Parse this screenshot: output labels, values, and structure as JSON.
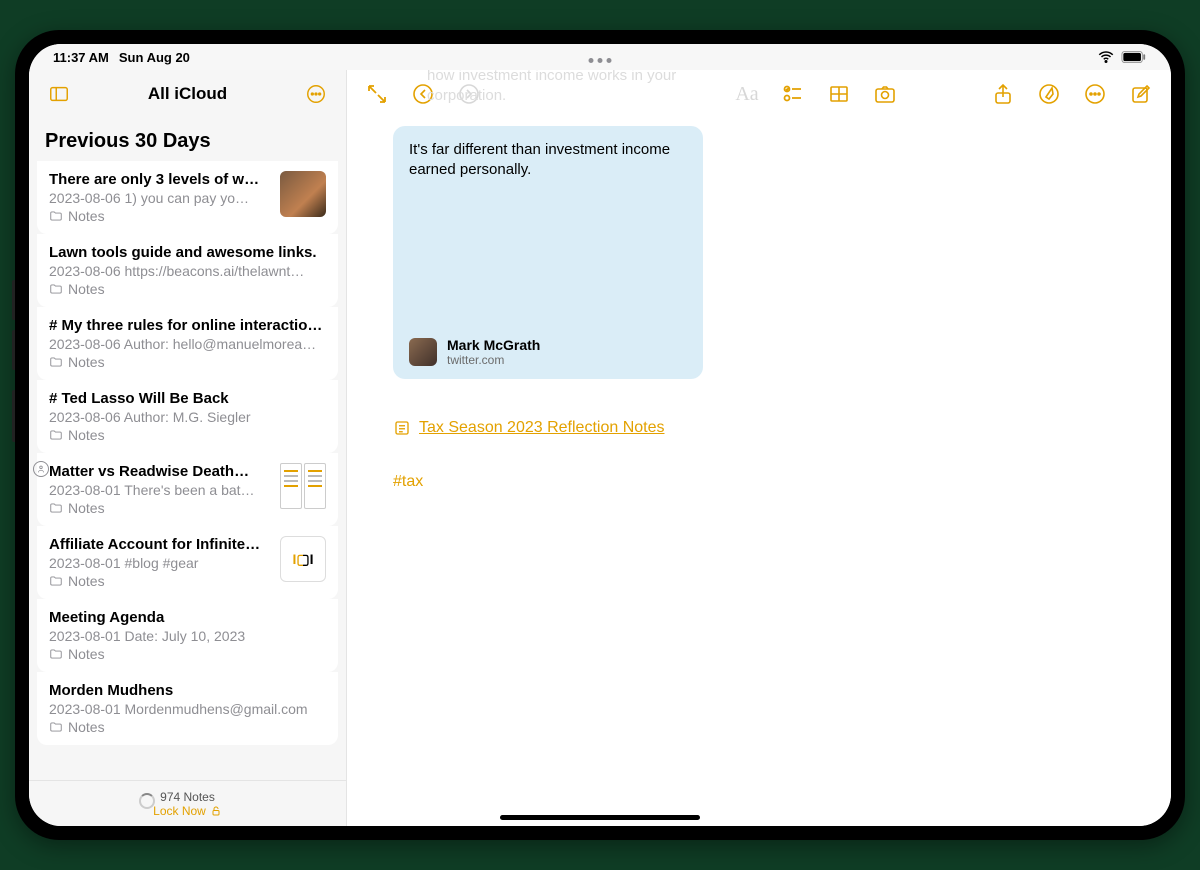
{
  "status": {
    "time": "11:37 AM",
    "date": "Sun Aug 20"
  },
  "sidebar": {
    "title": "All iCloud",
    "section": "Previous 30 Days",
    "footer_count": "974 Notes",
    "footer_lock": "Lock Now",
    "items": [
      {
        "title": "There are only 3 levels of w…",
        "date": "2023-08-06",
        "snippet": "1) you can pay yo…",
        "folder": "Notes",
        "thumb": "person"
      },
      {
        "title": "Lawn tools guide and awesome links.",
        "date": "2023-08-06",
        "snippet": "https://beacons.ai/thelawnt…",
        "folder": "Notes",
        "thumb": null
      },
      {
        "title": "# My three rules for online interactio…",
        "date": "2023-08-06",
        "snippet": "Author: hello@manuelmorea…",
        "folder": "Notes",
        "thumb": null
      },
      {
        "title": "# Ted Lasso Will Be Back",
        "date": "2023-08-06",
        "snippet": "Author: M.G. Siegler",
        "folder": "Notes",
        "thumb": null
      },
      {
        "title": "Matter vs Readwise Death…",
        "date": "2023-08-01",
        "snippet": "There's been a bat…",
        "folder": "Notes",
        "thumb": "split",
        "shared": true
      },
      {
        "title": "Affiliate Account for Infinite…",
        "date": "2023-08-01",
        "snippet": "#blog #gear",
        "folder": "Notes",
        "thumb": "logo"
      },
      {
        "title": "Meeting Agenda",
        "date": "2023-08-01",
        "snippet": "Date: July 10, 2023",
        "folder": "Notes",
        "thumb": null
      },
      {
        "title": "Morden Mudhens",
        "date": "2023-08-01",
        "snippet": "Mordenmudhens@gmail.com",
        "folder": "Notes",
        "thumb": null
      }
    ]
  },
  "editor": {
    "ghost_line1": "how investment income works in your",
    "ghost_line2": "corporation.",
    "embed": {
      "text": "It's far different than investment income earned personally.",
      "name": "Mark McGrath",
      "source": "twitter.com"
    },
    "link_text": "Tax Season 2023 Reflection Notes",
    "hashtag": "#tax"
  }
}
